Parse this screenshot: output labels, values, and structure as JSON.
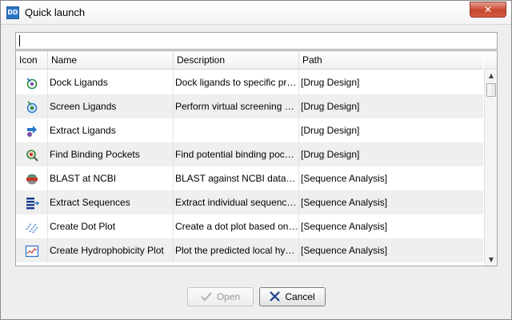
{
  "window": {
    "app_icon_text": "DD",
    "title": "Quick launch",
    "close_label": "✕"
  },
  "search": {
    "value": "",
    "placeholder": ""
  },
  "table": {
    "columns": [
      "Icon",
      "Name",
      "Description",
      "Path"
    ],
    "rows": [
      {
        "icon": "dock-ligands-icon",
        "name": "Dock Ligands",
        "description": "Dock ligands to specific prote…",
        "path": "[Drug Design]"
      },
      {
        "icon": "screen-ligands-icon",
        "name": "Screen Ligands",
        "description": "Perform virtual screening of …",
        "path": "[Drug Design]"
      },
      {
        "icon": "extract-ligands-icon",
        "name": "Extract Ligands",
        "description": "",
        "path": "[Drug Design]"
      },
      {
        "icon": "find-binding-pockets-icon",
        "name": "Find Binding Pockets",
        "description": "Find potential binding pocket…",
        "path": "[Drug Design]"
      },
      {
        "icon": "blast-ncbi-icon",
        "name": "BLAST at NCBI",
        "description": "BLAST against NCBI databas…",
        "path": "[Sequence Analysis]"
      },
      {
        "icon": "extract-sequences-icon",
        "name": "Extract Sequences",
        "description": "Extract individual sequences …",
        "path": "[Sequence Analysis]"
      },
      {
        "icon": "dot-plot-icon",
        "name": "Create Dot Plot",
        "description": "Create a dot plot based on o…",
        "path": "[Sequence Analysis]"
      },
      {
        "icon": "hydrophobicity-plot-icon",
        "name": "Create Hydrophobicity Plot",
        "description": "Plot the predicted local hydro…",
        "path": "[Sequence Analysis]"
      }
    ]
  },
  "scrollbar": {
    "up": "▲",
    "down": "▼"
  },
  "buttons": {
    "open_label": "Open",
    "cancel_label": "Cancel"
  },
  "colors": {
    "accent": "#2a76c6",
    "close": "#c7452e",
    "row_alt": "#efefef"
  }
}
